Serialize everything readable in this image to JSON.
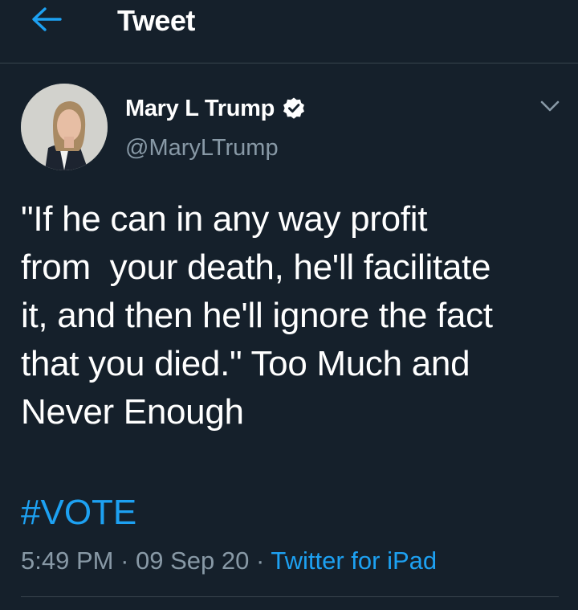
{
  "header": {
    "title": "Tweet",
    "back_icon": "arrow-left-icon"
  },
  "tweet": {
    "author": {
      "name": "Mary L Trump",
      "handle": "@MaryLTrump",
      "verified": true,
      "verified_icon": "verified-badge-icon"
    },
    "menu_icon": "chevron-down-icon",
    "text": "\"If he can in any way profit\nfrom  your death, he'll facilitate\nit, and then he'll ignore the fact\nthat you died.\" Too Much and\nNever Enough",
    "hashtag": "#VOTE",
    "time": "5:49 PM",
    "separator": "·",
    "date": "09 Sep 20",
    "source": "Twitter for iPad"
  },
  "colors": {
    "background": "#15202b",
    "text": "#ffffff",
    "secondary": "#8899a6",
    "accent": "#1da1f2",
    "divider": "#38444d"
  }
}
